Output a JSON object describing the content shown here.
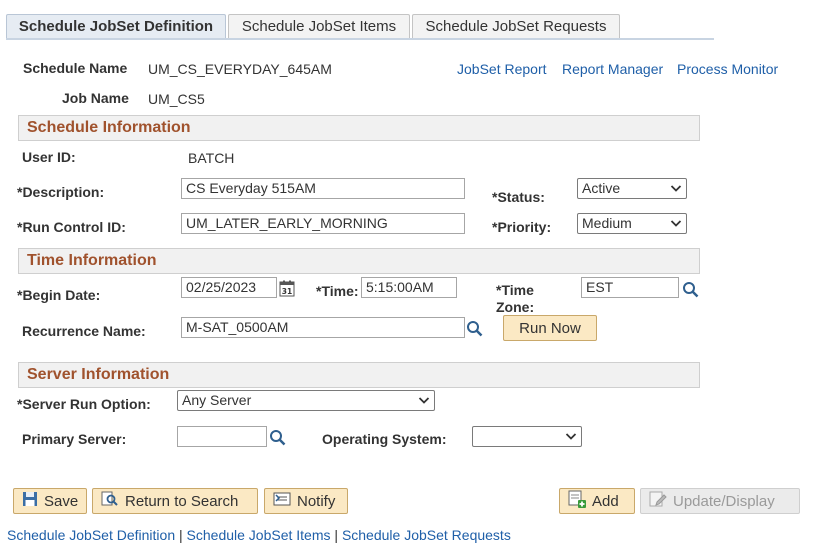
{
  "tabs": [
    {
      "label": "Schedule JobSet Definition",
      "active": true
    },
    {
      "label": "Schedule JobSet Items",
      "active": false
    },
    {
      "label": "Schedule JobSet Requests",
      "active": false
    }
  ],
  "header": {
    "schedule_name_label": "Schedule Name",
    "schedule_name_value": "UM_CS_EVERYDAY_645AM",
    "job_name_label": "Job Name",
    "job_name_value": "UM_CS5",
    "links": [
      "JobSet Report",
      "Report Manager",
      "Process Monitor"
    ]
  },
  "schedule_info": {
    "title": "Schedule Information",
    "user_id_label": "User ID:",
    "user_id_value": "BATCH",
    "description_label": "*Description:",
    "description_value": "CS Everyday 515AM",
    "status_label": "*Status:",
    "status_value": "Active",
    "run_control_label": "*Run Control ID:",
    "run_control_value": "UM_LATER_EARLY_MORNING",
    "priority_label": "*Priority:",
    "priority_value": "Medium"
  },
  "time_info": {
    "title": "Time Information",
    "begin_date_label": "*Begin Date:",
    "begin_date_value": "02/25/2023",
    "time_label": "*Time:",
    "time_value": "5:15:00AM",
    "time_zone_label_1": "*Time",
    "time_zone_label_2": "Zone:",
    "time_zone_value": "EST",
    "recurrence_label": "Recurrence Name:",
    "recurrence_value": "M-SAT_0500AM",
    "run_now_label": "Run Now",
    "calendar_day": "31"
  },
  "server_info": {
    "title": "Server Information",
    "run_option_label": "*Server Run Option:",
    "run_option_value": "Any Server",
    "primary_server_label": "Primary Server:",
    "primary_server_value": "",
    "os_label": "Operating System:",
    "os_value": ""
  },
  "toolbar": {
    "save_label": "Save",
    "return_label": "Return to Search",
    "notify_label": "Notify",
    "add_label": "Add",
    "update_label": "Update/Display"
  },
  "footer": {
    "links": [
      "Schedule JobSet Definition",
      "Schedule JobSet Items",
      "Schedule JobSet Requests"
    ],
    "separator": " | "
  },
  "colors": {
    "section_title": "#a0522d",
    "link": "#1f5fa8",
    "button_bg": "#fbe9c4",
    "active_tab_bg": "#e6ecf3"
  }
}
